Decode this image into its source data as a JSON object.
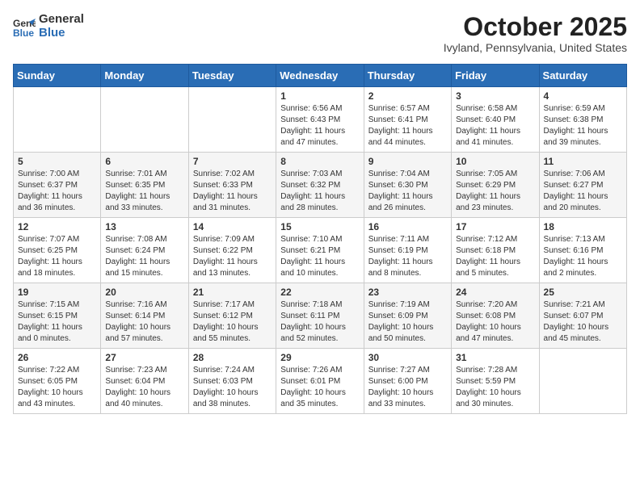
{
  "header": {
    "logo_general": "General",
    "logo_blue": "Blue",
    "month": "October 2025",
    "location": "Ivyland, Pennsylvania, United States"
  },
  "weekdays": [
    "Sunday",
    "Monday",
    "Tuesday",
    "Wednesday",
    "Thursday",
    "Friday",
    "Saturday"
  ],
  "weeks": [
    [
      {
        "day": "",
        "info": ""
      },
      {
        "day": "",
        "info": ""
      },
      {
        "day": "",
        "info": ""
      },
      {
        "day": "1",
        "info": "Sunrise: 6:56 AM\nSunset: 6:43 PM\nDaylight: 11 hours\nand 47 minutes."
      },
      {
        "day": "2",
        "info": "Sunrise: 6:57 AM\nSunset: 6:41 PM\nDaylight: 11 hours\nand 44 minutes."
      },
      {
        "day": "3",
        "info": "Sunrise: 6:58 AM\nSunset: 6:40 PM\nDaylight: 11 hours\nand 41 minutes."
      },
      {
        "day": "4",
        "info": "Sunrise: 6:59 AM\nSunset: 6:38 PM\nDaylight: 11 hours\nand 39 minutes."
      }
    ],
    [
      {
        "day": "5",
        "info": "Sunrise: 7:00 AM\nSunset: 6:37 PM\nDaylight: 11 hours\nand 36 minutes."
      },
      {
        "day": "6",
        "info": "Sunrise: 7:01 AM\nSunset: 6:35 PM\nDaylight: 11 hours\nand 33 minutes."
      },
      {
        "day": "7",
        "info": "Sunrise: 7:02 AM\nSunset: 6:33 PM\nDaylight: 11 hours\nand 31 minutes."
      },
      {
        "day": "8",
        "info": "Sunrise: 7:03 AM\nSunset: 6:32 PM\nDaylight: 11 hours\nand 28 minutes."
      },
      {
        "day": "9",
        "info": "Sunrise: 7:04 AM\nSunset: 6:30 PM\nDaylight: 11 hours\nand 26 minutes."
      },
      {
        "day": "10",
        "info": "Sunrise: 7:05 AM\nSunset: 6:29 PM\nDaylight: 11 hours\nand 23 minutes."
      },
      {
        "day": "11",
        "info": "Sunrise: 7:06 AM\nSunset: 6:27 PM\nDaylight: 11 hours\nand 20 minutes."
      }
    ],
    [
      {
        "day": "12",
        "info": "Sunrise: 7:07 AM\nSunset: 6:25 PM\nDaylight: 11 hours\nand 18 minutes."
      },
      {
        "day": "13",
        "info": "Sunrise: 7:08 AM\nSunset: 6:24 PM\nDaylight: 11 hours\nand 15 minutes."
      },
      {
        "day": "14",
        "info": "Sunrise: 7:09 AM\nSunset: 6:22 PM\nDaylight: 11 hours\nand 13 minutes."
      },
      {
        "day": "15",
        "info": "Sunrise: 7:10 AM\nSunset: 6:21 PM\nDaylight: 11 hours\nand 10 minutes."
      },
      {
        "day": "16",
        "info": "Sunrise: 7:11 AM\nSunset: 6:19 PM\nDaylight: 11 hours\nand 8 minutes."
      },
      {
        "day": "17",
        "info": "Sunrise: 7:12 AM\nSunset: 6:18 PM\nDaylight: 11 hours\nand 5 minutes."
      },
      {
        "day": "18",
        "info": "Sunrise: 7:13 AM\nSunset: 6:16 PM\nDaylight: 11 hours\nand 2 minutes."
      }
    ],
    [
      {
        "day": "19",
        "info": "Sunrise: 7:15 AM\nSunset: 6:15 PM\nDaylight: 11 hours\nand 0 minutes."
      },
      {
        "day": "20",
        "info": "Sunrise: 7:16 AM\nSunset: 6:14 PM\nDaylight: 10 hours\nand 57 minutes."
      },
      {
        "day": "21",
        "info": "Sunrise: 7:17 AM\nSunset: 6:12 PM\nDaylight: 10 hours\nand 55 minutes."
      },
      {
        "day": "22",
        "info": "Sunrise: 7:18 AM\nSunset: 6:11 PM\nDaylight: 10 hours\nand 52 minutes."
      },
      {
        "day": "23",
        "info": "Sunrise: 7:19 AM\nSunset: 6:09 PM\nDaylight: 10 hours\nand 50 minutes."
      },
      {
        "day": "24",
        "info": "Sunrise: 7:20 AM\nSunset: 6:08 PM\nDaylight: 10 hours\nand 47 minutes."
      },
      {
        "day": "25",
        "info": "Sunrise: 7:21 AM\nSunset: 6:07 PM\nDaylight: 10 hours\nand 45 minutes."
      }
    ],
    [
      {
        "day": "26",
        "info": "Sunrise: 7:22 AM\nSunset: 6:05 PM\nDaylight: 10 hours\nand 43 minutes."
      },
      {
        "day": "27",
        "info": "Sunrise: 7:23 AM\nSunset: 6:04 PM\nDaylight: 10 hours\nand 40 minutes."
      },
      {
        "day": "28",
        "info": "Sunrise: 7:24 AM\nSunset: 6:03 PM\nDaylight: 10 hours\nand 38 minutes."
      },
      {
        "day": "29",
        "info": "Sunrise: 7:26 AM\nSunset: 6:01 PM\nDaylight: 10 hours\nand 35 minutes."
      },
      {
        "day": "30",
        "info": "Sunrise: 7:27 AM\nSunset: 6:00 PM\nDaylight: 10 hours\nand 33 minutes."
      },
      {
        "day": "31",
        "info": "Sunrise: 7:28 AM\nSunset: 5:59 PM\nDaylight: 10 hours\nand 30 minutes."
      },
      {
        "day": "",
        "info": ""
      }
    ]
  ]
}
